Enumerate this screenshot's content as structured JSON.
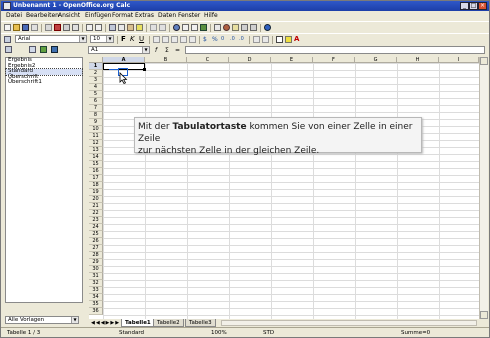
{
  "window": {
    "title": "Unbenannt 1 - OpenOffice.org Calc"
  },
  "menu": [
    "Datei",
    "Bearbeiten",
    "Ansicht",
    "Einfügen",
    "Format",
    "Extras",
    "Daten",
    "Fenster",
    "Hilfe"
  ],
  "formatting": {
    "font_name": "Arial",
    "font_size": "10"
  },
  "formula_bar": {
    "cell_ref": "A1",
    "content": ""
  },
  "styles_panel": {
    "items": [
      "Ergebnis",
      "Ergebnis2",
      "Standard",
      "Überschrift",
      "Überschrift1"
    ],
    "selected_index": 2,
    "filter": "Alle Vorlagen"
  },
  "grid": {
    "columns": [
      "A",
      "B",
      "C",
      "D",
      "E",
      "F",
      "G",
      "H",
      "I"
    ],
    "rows": [
      "1",
      "2",
      "3",
      "4",
      "5",
      "6",
      "7",
      "8",
      "9",
      "10",
      "11",
      "12",
      "13",
      "14",
      "15",
      "16",
      "17",
      "18",
      "19",
      "20",
      "21",
      "22",
      "23",
      "24",
      "25",
      "26",
      "27",
      "28",
      "29",
      "30",
      "31",
      "32",
      "33",
      "34",
      "35",
      "36"
    ],
    "active_cell": "A1"
  },
  "tooltip": {
    "line1_pre": "Mit der ",
    "line1_bold": "Tabulatortaste",
    "line1_post": " kommen Sie von einer Zelle in einer Zeile",
    "line2": "zur nächsten Zelle in der gleichen Zeile."
  },
  "sheet_tabs": [
    "Tabelle1",
    "Tabelle2",
    "Tabelle3"
  ],
  "status": {
    "sheet": "Tabelle 1 / 3",
    "style": "Standard",
    "zoom": "100%",
    "mode": "STD",
    "sum": "Summe=0"
  }
}
